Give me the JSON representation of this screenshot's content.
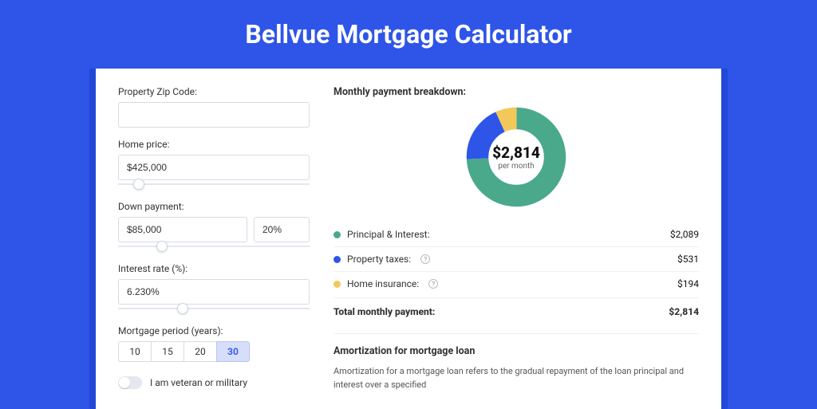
{
  "page_title": "Bellvue Mortgage Calculator",
  "form": {
    "zip_label": "Property Zip Code:",
    "zip_value": "",
    "home_price_label": "Home price:",
    "home_price_value": "$425,000",
    "home_price_slider_pct": 8,
    "down_payment_label": "Down payment:",
    "down_payment_value": "$85,000",
    "down_payment_pct_value": "20%",
    "down_payment_slider_pct": 20,
    "interest_rate_label": "Interest rate (%):",
    "interest_rate_value": "6.230%",
    "interest_rate_slider_pct": 31,
    "period_label": "Mortgage period (years):",
    "period_options": [
      "10",
      "15",
      "20",
      "30"
    ],
    "period_selected": "30",
    "veteran_label": "I am veteran or military",
    "veteran_value": false
  },
  "breakdown": {
    "title": "Monthly payment breakdown:",
    "center_value": "$2,814",
    "center_sub": "per month",
    "items": [
      {
        "label": "Principal & Interest:",
        "value": "$2,089",
        "color": "#49a98a",
        "help": false
      },
      {
        "label": "Property taxes:",
        "value": "$531",
        "color": "#2e55e8",
        "help": true
      },
      {
        "label": "Home insurance:",
        "value": "$194",
        "color": "#f3c85a",
        "help": true
      }
    ],
    "total_label": "Total monthly payment:",
    "total_value": "$2,814"
  },
  "chart_data": {
    "type": "pie",
    "title": "Monthly payment breakdown",
    "series": [
      {
        "name": "Principal & Interest",
        "value": 2089,
        "color": "#49a98a"
      },
      {
        "name": "Property taxes",
        "value": 531,
        "color": "#2e55e8"
      },
      {
        "name": "Home insurance",
        "value": 194,
        "color": "#f3c85a"
      }
    ],
    "total": 2814,
    "center_label": "$2,814 per month"
  },
  "amortization": {
    "title": "Amortization for mortgage loan",
    "text": "Amortization for a mortgage loan refers to the gradual repayment of the loan principal and interest over a specified"
  }
}
